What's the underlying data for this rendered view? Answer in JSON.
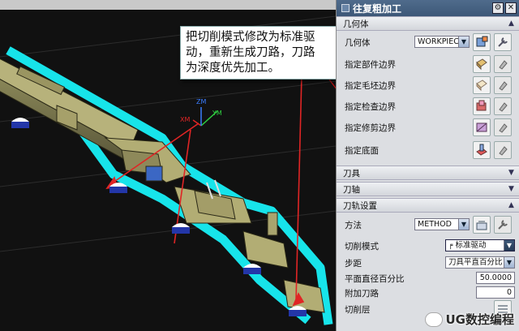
{
  "callout": {
    "line1": "把切削模式修改为标准驱",
    "line2": "动，重新生成刀路，刀路",
    "line3": "为深度优先加工。"
  },
  "viewport": {
    "axis_x": "XM",
    "axis_y": "YM",
    "axis_z": "ZM"
  },
  "panel": {
    "title": "往复粗加工",
    "close_glyph": "✕",
    "sections": {
      "geometry": "几何体",
      "tool": "刀具",
      "axis": "刀轴",
      "path_settings": "刀轨设置"
    },
    "geometry": {
      "geometry_label": "几何体",
      "geometry_value": "WORKPIECE",
      "part_boundary": "指定部件边界",
      "blank_boundary": "指定毛坯边界",
      "check_boundary": "指定检查边界",
      "trim_boundary": "指定修剪边界",
      "floor": "指定底面"
    },
    "path": {
      "method_label": "方法",
      "method_value": "METHOD",
      "cut_pattern_label": "切削模式",
      "cut_pattern_value": "标准驱动",
      "stepover_label": "步距",
      "stepover_value": "刀具平直百分比",
      "percent_label": "平面直径百分比",
      "percent_value": "50.0000",
      "additional_label": "附加刀路",
      "additional_value": "0",
      "levels_label": "切削层"
    },
    "icon_colors": {
      "accent": "#3d5878",
      "highlight": "#18e0e8"
    }
  },
  "watermark": {
    "text": "UG数控编程"
  }
}
